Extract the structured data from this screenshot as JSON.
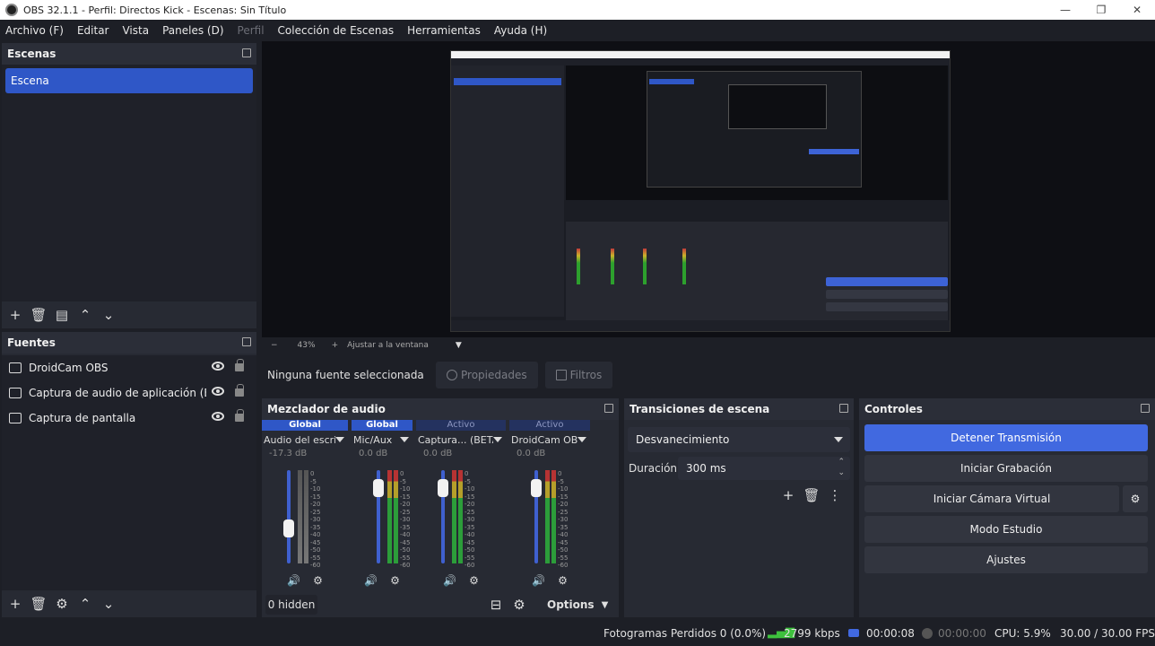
{
  "window": {
    "title": "OBS 32.1.1 - Perfil: Directos Kick - Escenas: Sin Título",
    "min": "—",
    "max": "❐",
    "close": "✕"
  },
  "menu": [
    "Archivo (F)",
    "Editar",
    "Vista",
    "Paneles (D)",
    "Perfil",
    "Colección de Escenas",
    "Herramientas",
    "Ayuda (H)"
  ],
  "scenes": {
    "title": "Escenas",
    "items": [
      "Escena"
    ]
  },
  "sources": {
    "title": "Fuentes",
    "items": [
      "DroidCam OBS",
      "Captura de audio de aplicación (BETA)",
      "Captura de pantalla"
    ]
  },
  "zoom": {
    "minus": "−",
    "value": "43%",
    "plus": "+",
    "fit": "Ajustar a la ventana"
  },
  "source_toolbar": {
    "none_selected": "Ninguna fuente seleccionada",
    "properties": "Propiedades",
    "filters": "Filtros"
  },
  "mixer": {
    "title": "Mezclador de audio",
    "channels": [
      {
        "head": "Global",
        "active": true,
        "name": "Audio del escritorio",
        "db": "-17.3 dB",
        "level": 0.35
      },
      {
        "head": "Global",
        "active": true,
        "name": "Mic/Aux",
        "db": "0.0 dB",
        "level": 0.88
      },
      {
        "head": "Activo",
        "active": false,
        "name": "Captura... (BETA)",
        "db": "0.0 dB",
        "level": 0.88
      },
      {
        "head": "Activo",
        "active": false,
        "name": "DroidCam OBS",
        "db": "0.0 dB",
        "level": 0.88
      }
    ],
    "scale": [
      "0",
      "-5",
      "-10",
      "-15",
      "-20",
      "-25",
      "-30",
      "-35",
      "-40",
      "-45",
      "-50",
      "-55",
      "-60"
    ],
    "hidden": "0 hidden",
    "options": "Options"
  },
  "transitions": {
    "title": "Transiciones de escena",
    "selected": "Desvanecimiento",
    "duration_label": "Duración",
    "duration_value": "300 ms"
  },
  "controls": {
    "title": "Controles",
    "stop_stream": "Detener Transmisión",
    "start_recording": "Iniciar Grabación",
    "virtual_cam": "Iniciar Cámara Virtual",
    "studio_mode": "Modo Estudio",
    "settings": "Ajustes"
  },
  "status": {
    "dropped": "Fotogramas Perdidos 0 (0.0%)",
    "bitrate": "2799 kbps",
    "stream_time": "00:00:08",
    "rec_time": "00:00:00",
    "cpu": "CPU: 5.9%",
    "fps": "30.00 / 30.00 FPS"
  },
  "colors": {
    "accent": "#4169e0",
    "scene_selected": "#2f57c7",
    "background": "#1d1f26",
    "panel": "#272a33"
  }
}
